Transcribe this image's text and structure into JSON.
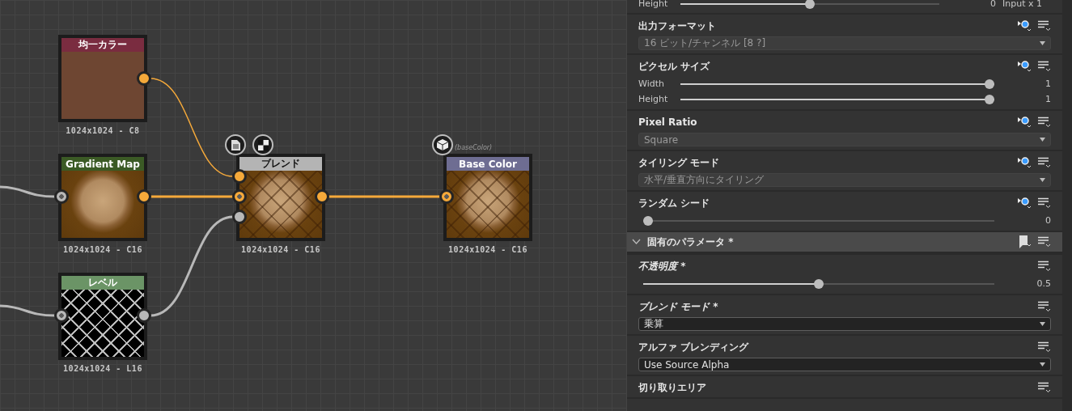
{
  "graph": {
    "nodes": [
      {
        "title": "均一カラー",
        "color": "#7a2c40",
        "info": "1024x1024 - C8"
      },
      {
        "title": "Gradient Map",
        "color": "#3b5a25",
        "info": "1024x1024 - C16"
      },
      {
        "title": "ブレンド",
        "color": "#b4b4b4",
        "info": "1024x1024 - C16"
      },
      {
        "title": "Base Color",
        "color": "#6e6d92",
        "info": "1024x1024 - C16",
        "caption": "(baseColor)"
      },
      {
        "title": "レベル",
        "color": "#6b9466",
        "info": "1024x1024 - L16"
      }
    ]
  },
  "panel": {
    "sections": [
      {
        "kind": "sliders",
        "rows": [
          {
            "label": "Height",
            "level": 0.5,
            "reading": "0",
            "note": "Input x 1"
          }
        ]
      },
      {
        "kind": "dropdown",
        "title": "出力フォーマット",
        "exposable": true,
        "modified": false,
        "value": "16 ビット/チャンネル [8 ?]",
        "disabled": true
      },
      {
        "kind": "sliders",
        "title": "ピクセル サイズ",
        "exposable": true,
        "modified": false,
        "rows": [
          {
            "label": "Width",
            "level": 1,
            "reading": "1"
          },
          {
            "label": "Height",
            "level": 1,
            "reading": "1"
          }
        ]
      },
      {
        "kind": "dropdown",
        "title": "Pixel Ratio",
        "exposable": true,
        "modified": false,
        "value": "Square",
        "disabled": true
      },
      {
        "kind": "dropdown",
        "title": "タイリング モード",
        "exposable": true,
        "modified": false,
        "value": "水平/垂直方向にタイリング",
        "disabled": true
      },
      {
        "kind": "sliders",
        "title": "ランダム シード",
        "exposable": true,
        "modified": false,
        "rows": [
          {
            "level": 0,
            "reading": "0"
          }
        ]
      },
      {
        "kind": "group",
        "title": "固有のパラメータ *",
        "expanded": true
      },
      {
        "kind": "sliders",
        "title": "不透明度 *",
        "modified": true,
        "rows": [
          {
            "level": 0.5,
            "reading": "0.5"
          }
        ]
      },
      {
        "kind": "dropdown",
        "title": "ブレンド モード *",
        "modified": true,
        "value": "乗算",
        "disabled": false
      },
      {
        "kind": "dropdown",
        "title": "アルファ ブレンディング",
        "modified": false,
        "value": "Use Source Alpha",
        "disabled": false
      },
      {
        "kind": "label",
        "title": "切り取りエリア",
        "modified": false
      }
    ]
  }
}
